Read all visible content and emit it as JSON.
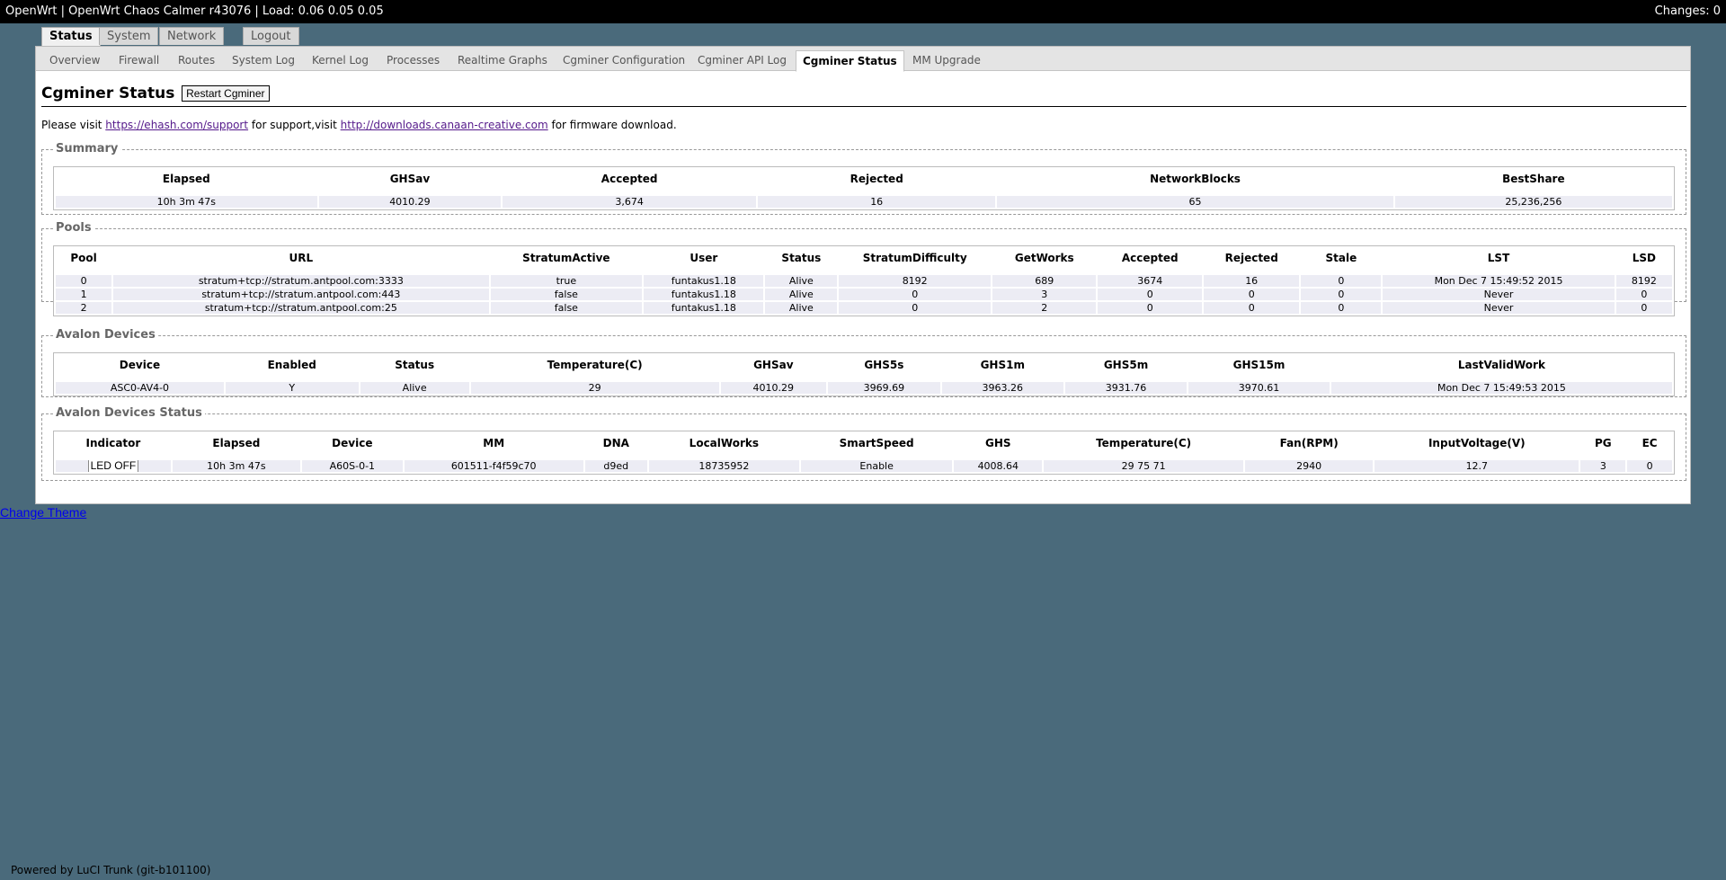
{
  "topbar": {
    "title": "OpenWrt | OpenWrt Chaos Calmer r43076 | Load: 0.06 0.05 0.05",
    "changes": "Changes: 0"
  },
  "maintabs": [
    "Status",
    "System",
    "Network",
    "Logout"
  ],
  "subtabs": [
    "Overview",
    "Firewall",
    "Routes",
    "System Log",
    "Kernel Log",
    "Processes",
    "Realtime Graphs",
    "Cgminer Configuration",
    "Cgminer API Log",
    "Cgminer Status",
    "MM Upgrade"
  ],
  "page": {
    "title": "Cgminer Status",
    "restart_label": "Restart Cgminer",
    "visit_prefix": "Please visit ",
    "support_link": "https://ehash.com/support",
    "visit_mid": " for support,visit ",
    "download_link": "http://downloads.canaan-creative.com",
    "visit_suffix": " for firmware download."
  },
  "summary": {
    "legend": "Summary",
    "headers": [
      "Elapsed",
      "GHSav",
      "Accepted",
      "Rejected",
      "NetworkBlocks",
      "BestShare"
    ],
    "rows": [
      [
        "10h 3m 47s",
        "4010.29",
        "3,674",
        "16",
        "65",
        "25,236,256"
      ]
    ]
  },
  "pools": {
    "legend": "Pools",
    "headers": [
      "Pool",
      "URL",
      "StratumActive",
      "User",
      "Status",
      "StratumDifficulty",
      "GetWorks",
      "Accepted",
      "Rejected",
      "Stale",
      "LST",
      "LSD"
    ],
    "rows": [
      [
        "0",
        "stratum+tcp://stratum.antpool.com:3333",
        "true",
        "funtakus1.18",
        "Alive",
        "8192",
        "689",
        "3674",
        "16",
        "0",
        "Mon Dec 7 15:49:52 2015",
        "8192"
      ],
      [
        "1",
        "stratum+tcp://stratum.antpool.com:443",
        "false",
        "funtakus1.18",
        "Alive",
        "0",
        "3",
        "0",
        "0",
        "0",
        "Never",
        "0"
      ],
      [
        "2",
        "stratum+tcp://stratum.antpool.com:25",
        "false",
        "funtakus1.18",
        "Alive",
        "0",
        "2",
        "0",
        "0",
        "0",
        "Never",
        "0"
      ]
    ]
  },
  "devices": {
    "legend": "Avalon Devices",
    "headers": [
      "Device",
      "Enabled",
      "Status",
      "Temperature(C)",
      "GHSav",
      "GHS5s",
      "GHS1m",
      "GHS5m",
      "GHS15m",
      "LastValidWork"
    ],
    "rows": [
      [
        "ASC0-AV4-0",
        "Y",
        "Alive",
        "29",
        "4010.29",
        "3969.69",
        "3963.26",
        "3931.76",
        "3970.61",
        "Mon Dec 7 15:49:53 2015"
      ]
    ]
  },
  "devstatus": {
    "legend": "Avalon Devices Status",
    "headers": [
      "Indicator",
      "Elapsed",
      "Device",
      "MM",
      "DNA",
      "LocalWorks",
      "SmartSpeed",
      "GHS",
      "Temperature(C)",
      "Fan(RPM)",
      "InputVoltage(V)",
      "PG",
      "EC"
    ],
    "led_label": "LED OFF",
    "rows": [
      [
        "10h 3m 47s",
        "A60S-0-1",
        "601511-f4f59c70",
        "d9ed",
        "18735952",
        "Enable",
        "4008.64",
        "29 75 71",
        "2940",
        "12.7",
        "3",
        "0"
      ]
    ]
  },
  "change_theme": "Change Theme",
  "footer": "Powered by LuCI Trunk (git-b101100)"
}
